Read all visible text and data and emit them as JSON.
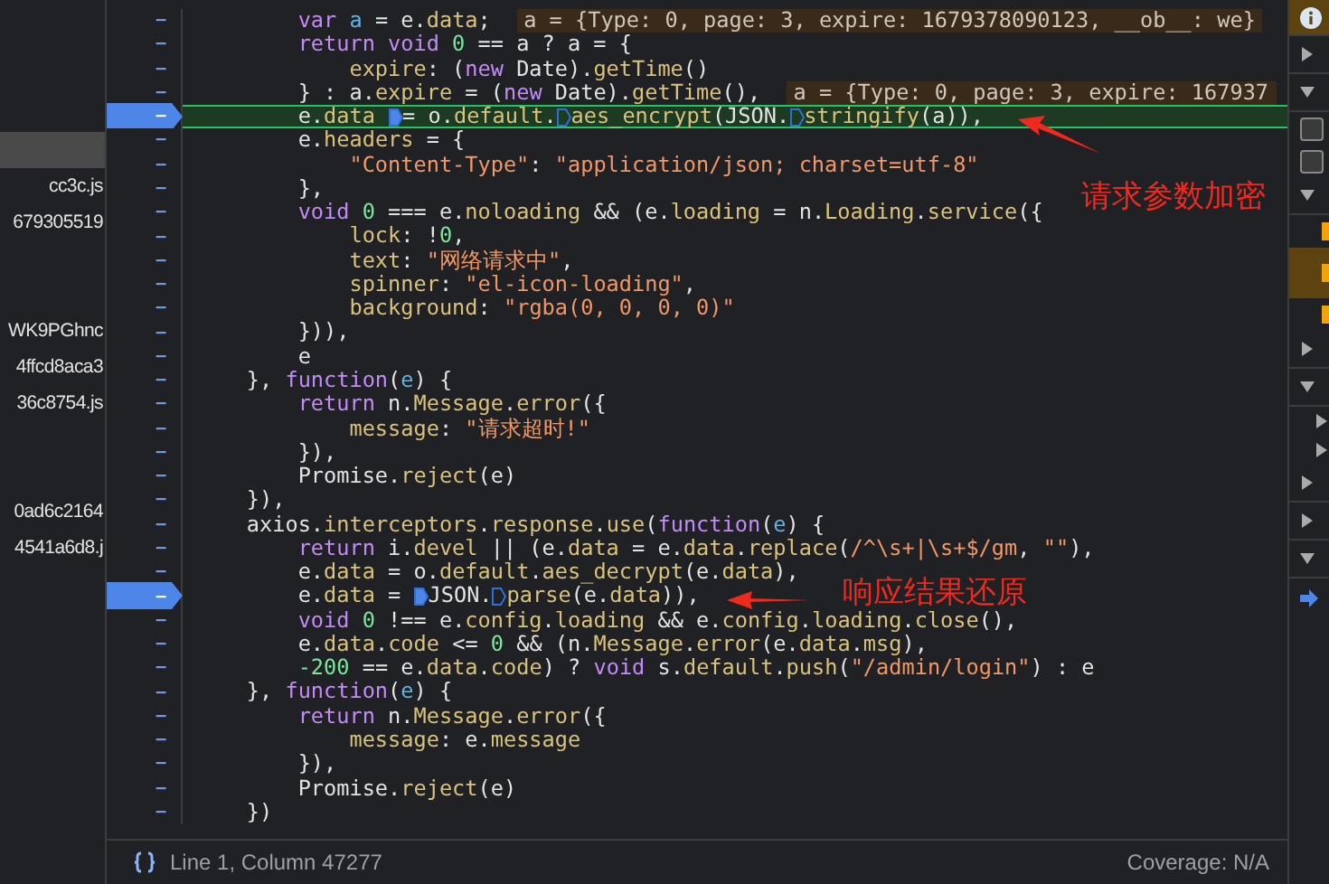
{
  "file_list": [
    {
      "kind": "file",
      "selected": true
    },
    {
      "kind": "file",
      "label": "cc3c.js",
      "selected": false
    },
    {
      "kind": "file",
      "label": "679305519",
      "selected": false
    },
    {
      "kind": "spacer"
    },
    {
      "kind": "spacer"
    },
    {
      "kind": "file",
      "label": "WK9PGhnc",
      "selected": false
    },
    {
      "kind": "file",
      "label": "4ffcd8aca3",
      "selected": false
    },
    {
      "kind": "file",
      "label": "36c8754.js",
      "selected": false
    },
    {
      "kind": "spacer"
    },
    {
      "kind": "spacer"
    },
    {
      "kind": "file",
      "label": "0ad6c2164",
      "selected": false
    },
    {
      "kind": "file",
      "label": "4541a6d8.j",
      "selected": false
    }
  ],
  "code_lines": [
    {
      "mark": "–",
      "breakpoint": false,
      "highlighted": false,
      "tokens": [
        {
          "kind": "keyword",
          "text": "        var "
        },
        {
          "kind": "variable",
          "text": "a"
        },
        {
          "kind": "plain",
          "text": " = e."
        },
        {
          "kind": "property",
          "text": "data"
        },
        {
          "kind": "plain",
          "text": ";  "
        },
        {
          "kind": "inline",
          "text": "a = {Type: 0, page: 3, expire: 1679378090123, __ob__: we}"
        }
      ]
    },
    {
      "mark": "–",
      "breakpoint": false,
      "highlighted": false,
      "tokens": [
        {
          "kind": "keyword",
          "text": "        return void "
        },
        {
          "kind": "number",
          "text": "0"
        },
        {
          "kind": "plain",
          "text": " == a ? a = {"
        }
      ]
    },
    {
      "mark": "–",
      "breakpoint": false,
      "highlighted": false,
      "tokens": [
        {
          "kind": "property",
          "text": "            expire"
        },
        {
          "kind": "plain",
          "text": ": ("
        },
        {
          "kind": "keyword",
          "text": "new"
        },
        {
          "kind": "plain",
          "text": " Date)."
        },
        {
          "kind": "property",
          "text": "getTime"
        },
        {
          "kind": "plain",
          "text": "()"
        }
      ]
    },
    {
      "mark": "–",
      "breakpoint": false,
      "highlighted": false,
      "tokens": [
        {
          "kind": "plain",
          "text": "        } : a."
        },
        {
          "kind": "property",
          "text": "expire"
        },
        {
          "kind": "plain",
          "text": " = ("
        },
        {
          "kind": "keyword",
          "text": "new"
        },
        {
          "kind": "plain",
          "text": " Date)."
        },
        {
          "kind": "property",
          "text": "getTime"
        },
        {
          "kind": "plain",
          "text": "(),  "
        },
        {
          "kind": "inline",
          "text": "a = {Type: 0, page: 3, expire: 167937"
        }
      ]
    },
    {
      "mark": "–",
      "breakpoint": true,
      "highlighted": true,
      "tokens": [
        {
          "kind": "plain",
          "text": "        e."
        },
        {
          "kind": "property",
          "text": "data "
        },
        {
          "kind": "marker",
          "filled": true
        },
        {
          "kind": "plain",
          "text": "= o."
        },
        {
          "kind": "property",
          "text": "default"
        },
        {
          "kind": "plain",
          "text": "."
        },
        {
          "kind": "marker",
          "filled": false
        },
        {
          "kind": "property",
          "text": "aes_encrypt"
        },
        {
          "kind": "plain",
          "text": "(JSON."
        },
        {
          "kind": "marker",
          "filled": false
        },
        {
          "kind": "property",
          "text": "stringify"
        },
        {
          "kind": "plain",
          "text": "(a)),"
        }
      ]
    },
    {
      "mark": "–",
      "breakpoint": false,
      "highlighted": false,
      "tokens": [
        {
          "kind": "plain",
          "text": "        e."
        },
        {
          "kind": "property",
          "text": "headers"
        },
        {
          "kind": "plain",
          "text": " = {"
        }
      ]
    },
    {
      "mark": "–",
      "breakpoint": false,
      "highlighted": false,
      "tokens": [
        {
          "kind": "string",
          "text": "            \"Content-Type\""
        },
        {
          "kind": "plain",
          "text": ": "
        },
        {
          "kind": "string",
          "text": "\"application/json; charset=utf-8\""
        }
      ]
    },
    {
      "mark": "–",
      "breakpoint": false,
      "highlighted": false,
      "tokens": [
        {
          "kind": "plain",
          "text": "        },"
        }
      ]
    },
    {
      "mark": "–",
      "breakpoint": false,
      "highlighted": false,
      "tokens": [
        {
          "kind": "keyword",
          "text": "        void "
        },
        {
          "kind": "number",
          "text": "0"
        },
        {
          "kind": "plain",
          "text": " === e."
        },
        {
          "kind": "property",
          "text": "noloading"
        },
        {
          "kind": "plain",
          "text": " && (e."
        },
        {
          "kind": "property",
          "text": "loading"
        },
        {
          "kind": "plain",
          "text": " = n."
        },
        {
          "kind": "property",
          "text": "Loading"
        },
        {
          "kind": "plain",
          "text": "."
        },
        {
          "kind": "property",
          "text": "service"
        },
        {
          "kind": "plain",
          "text": "({"
        }
      ]
    },
    {
      "mark": "–",
      "breakpoint": false,
      "highlighted": false,
      "tokens": [
        {
          "kind": "property",
          "text": "            lock"
        },
        {
          "kind": "plain",
          "text": ": !"
        },
        {
          "kind": "number",
          "text": "0"
        },
        {
          "kind": "plain",
          "text": ","
        }
      ]
    },
    {
      "mark": "–",
      "breakpoint": false,
      "highlighted": false,
      "tokens": [
        {
          "kind": "property",
          "text": "            text"
        },
        {
          "kind": "plain",
          "text": ": "
        },
        {
          "kind": "string",
          "text": "\"网络请求中\""
        },
        {
          "kind": "plain",
          "text": ","
        }
      ]
    },
    {
      "mark": "–",
      "breakpoint": false,
      "highlighted": false,
      "tokens": [
        {
          "kind": "property",
          "text": "            spinner"
        },
        {
          "kind": "plain",
          "text": ": "
        },
        {
          "kind": "string",
          "text": "\"el-icon-loading\""
        },
        {
          "kind": "plain",
          "text": ","
        }
      ]
    },
    {
      "mark": "–",
      "breakpoint": false,
      "highlighted": false,
      "tokens": [
        {
          "kind": "property",
          "text": "            background"
        },
        {
          "kind": "plain",
          "text": ": "
        },
        {
          "kind": "string",
          "text": "\"rgba(0, 0, 0, 0)\""
        }
      ]
    },
    {
      "mark": "–",
      "breakpoint": false,
      "highlighted": false,
      "tokens": [
        {
          "kind": "plain",
          "text": "        })),"
        }
      ]
    },
    {
      "mark": "–",
      "breakpoint": false,
      "highlighted": false,
      "tokens": [
        {
          "kind": "plain",
          "text": "        e"
        }
      ]
    },
    {
      "mark": "–",
      "breakpoint": false,
      "highlighted": false,
      "tokens": [
        {
          "kind": "plain",
          "text": "    }, "
        },
        {
          "kind": "keyword",
          "text": "function"
        },
        {
          "kind": "plain",
          "text": "("
        },
        {
          "kind": "variable",
          "text": "e"
        },
        {
          "kind": "plain",
          "text": ") {"
        }
      ]
    },
    {
      "mark": "–",
      "breakpoint": false,
      "highlighted": false,
      "tokens": [
        {
          "kind": "keyword",
          "text": "        return"
        },
        {
          "kind": "plain",
          "text": " n."
        },
        {
          "kind": "property",
          "text": "Message"
        },
        {
          "kind": "plain",
          "text": "."
        },
        {
          "kind": "property",
          "text": "error"
        },
        {
          "kind": "plain",
          "text": "({"
        }
      ]
    },
    {
      "mark": "–",
      "breakpoint": false,
      "highlighted": false,
      "tokens": [
        {
          "kind": "property",
          "text": "            message"
        },
        {
          "kind": "plain",
          "text": ": "
        },
        {
          "kind": "string",
          "text": "\"请求超时!\""
        }
      ]
    },
    {
      "mark": "–",
      "breakpoint": false,
      "highlighted": false,
      "tokens": [
        {
          "kind": "plain",
          "text": "        }),"
        }
      ]
    },
    {
      "mark": "–",
      "breakpoint": false,
      "highlighted": false,
      "tokens": [
        {
          "kind": "plain",
          "text": "        Promise."
        },
        {
          "kind": "property",
          "text": "reject"
        },
        {
          "kind": "plain",
          "text": "(e)"
        }
      ]
    },
    {
      "mark": "–",
      "breakpoint": false,
      "highlighted": false,
      "tokens": [
        {
          "kind": "plain",
          "text": "    }),"
        }
      ]
    },
    {
      "mark": "–",
      "breakpoint": false,
      "highlighted": false,
      "tokens": [
        {
          "kind": "plain",
          "text": "    axios."
        },
        {
          "kind": "property",
          "text": "interceptors"
        },
        {
          "kind": "plain",
          "text": "."
        },
        {
          "kind": "property",
          "text": "response"
        },
        {
          "kind": "plain",
          "text": "."
        },
        {
          "kind": "property",
          "text": "use"
        },
        {
          "kind": "plain",
          "text": "("
        },
        {
          "kind": "keyword",
          "text": "function"
        },
        {
          "kind": "plain",
          "text": "("
        },
        {
          "kind": "variable",
          "text": "e"
        },
        {
          "kind": "plain",
          "text": ") {"
        }
      ]
    },
    {
      "mark": "–",
      "breakpoint": false,
      "highlighted": false,
      "tokens": [
        {
          "kind": "keyword",
          "text": "        return"
        },
        {
          "kind": "plain",
          "text": " i."
        },
        {
          "kind": "property",
          "text": "devel"
        },
        {
          "kind": "plain",
          "text": " || (e."
        },
        {
          "kind": "property",
          "text": "data"
        },
        {
          "kind": "plain",
          "text": " = e."
        },
        {
          "kind": "property",
          "text": "data"
        },
        {
          "kind": "plain",
          "text": "."
        },
        {
          "kind": "property",
          "text": "replace"
        },
        {
          "kind": "plain",
          "text": "("
        },
        {
          "kind": "string",
          "text": "/^\\s+|\\s+$/gm"
        },
        {
          "kind": "plain",
          "text": ", "
        },
        {
          "kind": "string",
          "text": "\"\""
        },
        {
          "kind": "plain",
          "text": "),"
        }
      ]
    },
    {
      "mark": "–",
      "breakpoint": false,
      "highlighted": false,
      "tokens": [
        {
          "kind": "plain",
          "text": "        e."
        },
        {
          "kind": "property",
          "text": "data"
        },
        {
          "kind": "plain",
          "text": " = o."
        },
        {
          "kind": "property",
          "text": "default"
        },
        {
          "kind": "plain",
          "text": "."
        },
        {
          "kind": "property",
          "text": "aes_decrypt"
        },
        {
          "kind": "plain",
          "text": "(e."
        },
        {
          "kind": "property",
          "text": "data"
        },
        {
          "kind": "plain",
          "text": "),"
        }
      ]
    },
    {
      "mark": "–",
      "breakpoint": true,
      "highlighted": false,
      "tokens": [
        {
          "kind": "plain",
          "text": "        e."
        },
        {
          "kind": "property",
          "text": "data"
        },
        {
          "kind": "plain",
          "text": " = "
        },
        {
          "kind": "marker",
          "filled": true
        },
        {
          "kind": "plain",
          "text": "JSON."
        },
        {
          "kind": "marker",
          "filled": false
        },
        {
          "kind": "property",
          "text": "parse"
        },
        {
          "kind": "plain",
          "text": "(e."
        },
        {
          "kind": "property",
          "text": "data"
        },
        {
          "kind": "plain",
          "text": ")),"
        }
      ]
    },
    {
      "mark": "–",
      "breakpoint": false,
      "highlighted": false,
      "tokens": [
        {
          "kind": "keyword",
          "text": "        void "
        },
        {
          "kind": "number",
          "text": "0"
        },
        {
          "kind": "plain",
          "text": " !== e."
        },
        {
          "kind": "property",
          "text": "config"
        },
        {
          "kind": "plain",
          "text": "."
        },
        {
          "kind": "property",
          "text": "loading"
        },
        {
          "kind": "plain",
          "text": " && e."
        },
        {
          "kind": "property",
          "text": "config"
        },
        {
          "kind": "plain",
          "text": "."
        },
        {
          "kind": "property",
          "text": "loading"
        },
        {
          "kind": "plain",
          "text": "."
        },
        {
          "kind": "property",
          "text": "close"
        },
        {
          "kind": "plain",
          "text": "(),"
        }
      ]
    },
    {
      "mark": "–",
      "breakpoint": false,
      "highlighted": false,
      "tokens": [
        {
          "kind": "plain",
          "text": "        e."
        },
        {
          "kind": "property",
          "text": "data"
        },
        {
          "kind": "plain",
          "text": "."
        },
        {
          "kind": "property",
          "text": "code"
        },
        {
          "kind": "plain",
          "text": " <= "
        },
        {
          "kind": "number",
          "text": "0"
        },
        {
          "kind": "plain",
          "text": " && (n."
        },
        {
          "kind": "property",
          "text": "Message"
        },
        {
          "kind": "plain",
          "text": "."
        },
        {
          "kind": "property",
          "text": "error"
        },
        {
          "kind": "plain",
          "text": "(e."
        },
        {
          "kind": "property",
          "text": "data"
        },
        {
          "kind": "plain",
          "text": "."
        },
        {
          "kind": "property",
          "text": "msg"
        },
        {
          "kind": "plain",
          "text": "),"
        }
      ]
    },
    {
      "mark": "–",
      "breakpoint": false,
      "highlighted": false,
      "tokens": [
        {
          "kind": "number",
          "text": "        -200"
        },
        {
          "kind": "plain",
          "text": " == e."
        },
        {
          "kind": "property",
          "text": "data"
        },
        {
          "kind": "plain",
          "text": "."
        },
        {
          "kind": "property",
          "text": "code"
        },
        {
          "kind": "plain",
          "text": ") ? "
        },
        {
          "kind": "keyword",
          "text": "void"
        },
        {
          "kind": "plain",
          "text": " s."
        },
        {
          "kind": "property",
          "text": "default"
        },
        {
          "kind": "plain",
          "text": "."
        },
        {
          "kind": "property",
          "text": "push"
        },
        {
          "kind": "plain",
          "text": "("
        },
        {
          "kind": "string",
          "text": "\"/admin/login\""
        },
        {
          "kind": "plain",
          "text": ") : e"
        }
      ]
    },
    {
      "mark": "–",
      "breakpoint": false,
      "highlighted": false,
      "tokens": [
        {
          "kind": "plain",
          "text": "    }, "
        },
        {
          "kind": "keyword",
          "text": "function"
        },
        {
          "kind": "plain",
          "text": "("
        },
        {
          "kind": "variable",
          "text": "e"
        },
        {
          "kind": "plain",
          "text": ") {"
        }
      ]
    },
    {
      "mark": "–",
      "breakpoint": false,
      "highlighted": false,
      "tokens": [
        {
          "kind": "keyword",
          "text": "        return"
        },
        {
          "kind": "plain",
          "text": " n."
        },
        {
          "kind": "property",
          "text": "Message"
        },
        {
          "kind": "plain",
          "text": "."
        },
        {
          "kind": "property",
          "text": "error"
        },
        {
          "kind": "plain",
          "text": "({"
        }
      ]
    },
    {
      "mark": "–",
      "breakpoint": false,
      "highlighted": false,
      "tokens": [
        {
          "kind": "property",
          "text": "            message"
        },
        {
          "kind": "plain",
          "text": ": e."
        },
        {
          "kind": "property",
          "text": "message"
        }
      ]
    },
    {
      "mark": "–",
      "breakpoint": false,
      "highlighted": false,
      "tokens": [
        {
          "kind": "plain",
          "text": "        }),"
        }
      ]
    },
    {
      "mark": "–",
      "breakpoint": false,
      "highlighted": false,
      "tokens": [
        {
          "kind": "plain",
          "text": "        Promise."
        },
        {
          "kind": "property",
          "text": "reject"
        },
        {
          "kind": "plain",
          "text": "(e)"
        }
      ]
    },
    {
      "mark": "–",
      "breakpoint": false,
      "highlighted": false,
      "tokens": [
        {
          "kind": "plain",
          "text": "    })"
        }
      ]
    }
  ],
  "annotations": [
    {
      "text": "请求参数加密"
    },
    {
      "text": "响应结果还原"
    }
  ],
  "status_bar": {
    "position": "Line 1, Column 47277",
    "coverage": "Coverage: N/A"
  },
  "side_panel": [
    {
      "kind": "info"
    },
    {
      "kind": "section",
      "expanded": false
    },
    {
      "kind": "section",
      "expanded": true
    },
    {
      "kind": "checkbox",
      "checked": false
    },
    {
      "kind": "checkbox",
      "checked": false
    },
    {
      "kind": "section",
      "expanded": true
    },
    {
      "kind": "entry",
      "selected": false
    },
    {
      "kind": "entry",
      "selected": true
    },
    {
      "kind": "entry",
      "selected": false
    },
    {
      "kind": "section",
      "expanded": false
    },
    {
      "kind": "section",
      "expanded": true
    },
    {
      "kind": "node",
      "expanded": false
    },
    {
      "kind": "node",
      "expanded": false
    },
    {
      "kind": "section",
      "expanded": false
    },
    {
      "kind": "section",
      "expanded": false
    },
    {
      "kind": "section",
      "expanded": true
    },
    {
      "kind": "frame"
    }
  ]
}
